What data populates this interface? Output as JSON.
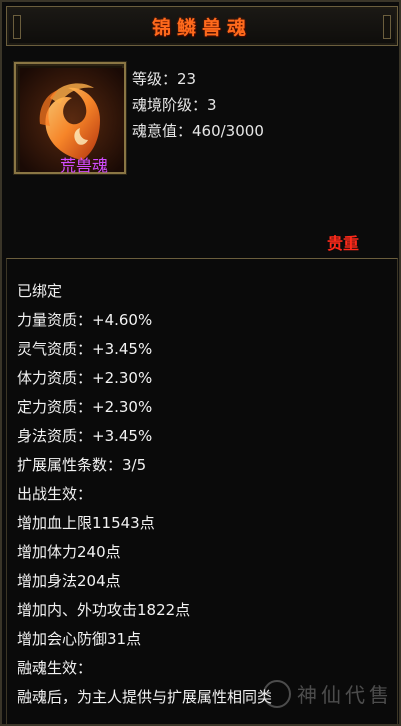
{
  "title": "锦鳞兽魂",
  "stats": {
    "level": "等级：23",
    "tier": "魂境阶级：3",
    "will": "魂意值：460/3000"
  },
  "type_name": "荒兽魂",
  "rarity": "贵重",
  "bound": "已绑定",
  "attributes": [
    "力量资质：+4.60%",
    "灵气资质：+3.45%",
    "体力资质：+2.30%",
    "定力资质：+2.30%",
    "身法资质：+3.45%"
  ],
  "extend_count": "扩展属性条数：3/5",
  "battle_effect_label": "出战生效：",
  "active_effects": [
    "增加血上限11543点",
    "增加体力240点",
    "增加身法204点"
  ],
  "inactive_effects": [
    "增加内、外功攻击1822点",
    "增加会心防御31点"
  ],
  "fusion_label": "融魂生效：",
  "fusion_desc": "融魂后，为主人提供与扩展属性相同类",
  "watermark": "神仙代售",
  "colors": {
    "title": "#ff6a1c",
    "purple": "#d24cff",
    "rarity": "#ff2a1a",
    "bound": "#bfe7ff",
    "gray": "#6f6f6f"
  },
  "icon": "flame-beast-soul-icon"
}
